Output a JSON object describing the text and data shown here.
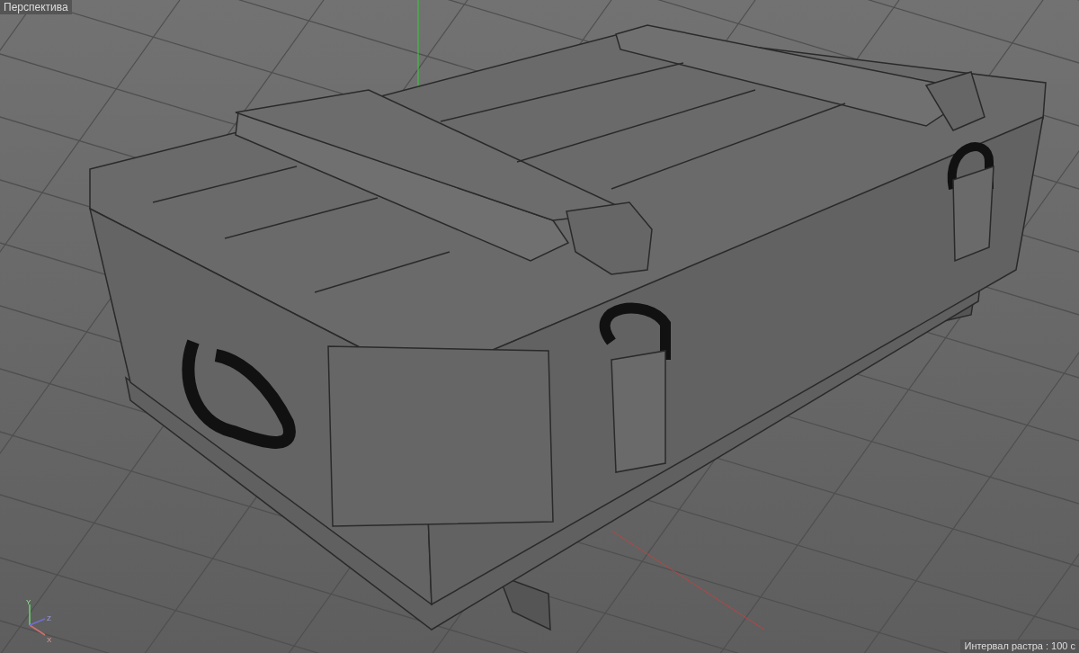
{
  "viewport": {
    "title": "Перспектива",
    "grid_spacing": "Интервал растра : 100 c",
    "axes": [
      "Y",
      "Z",
      "X"
    ]
  }
}
